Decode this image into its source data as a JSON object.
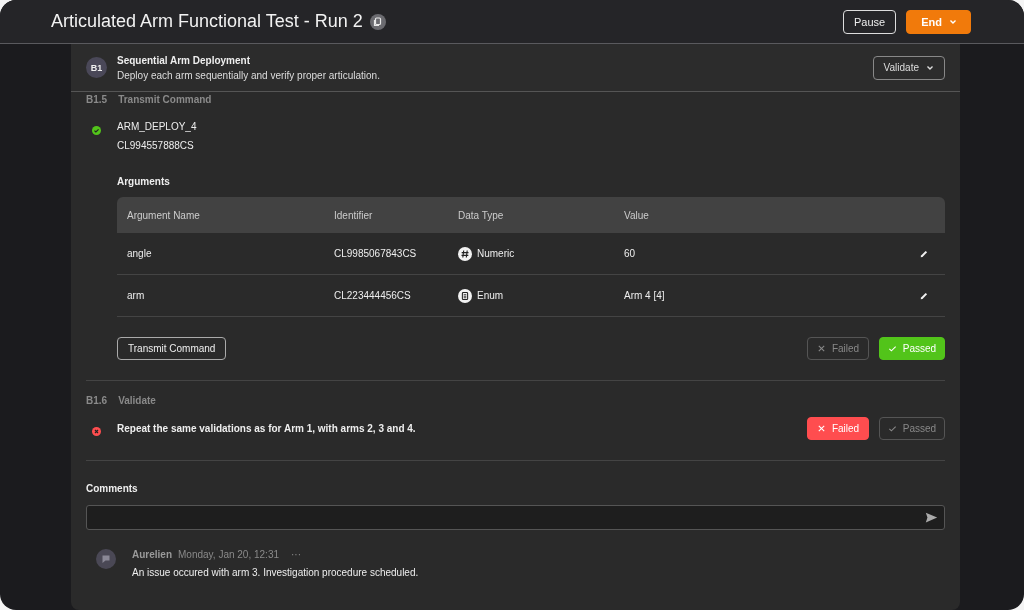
{
  "header": {
    "title": "Articulated Arm Functional Test - Run 2",
    "buttons": [
      {
        "label": "Pause",
        "kind": "outline"
      },
      {
        "label": "End",
        "kind": "primary"
      }
    ]
  },
  "block": {
    "badge": "B1",
    "title": "Sequential Arm Deployment",
    "description": "Deploy each arm sequentially and verify proper articulation.",
    "action": "Validate"
  },
  "steps": [
    {
      "number": "B1.5",
      "type": "Transmit Command",
      "passed": true,
      "kind": "command",
      "command": "ARM_DEPLOY_4",
      "identifier": "CL994557888CS",
      "arguments_title": "Arguments",
      "columns": [
        "Argument Name",
        "Identifier",
        "Data Type",
        "Value"
      ],
      "rows": [
        {
          "name": "angle",
          "identifier": "CL9985067843CS",
          "data_type": "Numeric",
          "kind": "numeric",
          "value": "60"
        },
        {
          "name": "arm",
          "identifier": "CL223444456CS",
          "data_type": "Enum",
          "kind": "enum",
          "value": "Arm 4 [4]"
        }
      ],
      "action": "Transmit Command",
      "verdicts": [
        {
          "label": "Failed",
          "kind": "failed",
          "selected": false
        },
        {
          "label": "Passed",
          "kind": "passed",
          "selected": true
        }
      ]
    },
    {
      "number": "B1.6",
      "type": "Validate",
      "passed": false,
      "kind": "validate",
      "text": "Repeat the same validations as for Arm 1, with arms 2, 3 and 4.",
      "verdicts": [
        {
          "label": "Failed",
          "kind": "failed",
          "selected": true
        },
        {
          "label": "Passed",
          "kind": "passed",
          "selected": false
        }
      ]
    }
  ],
  "comments": {
    "title": "Comments",
    "items": [
      {
        "author": "Aurelien",
        "time": "Monday, Jan 20, 12:31",
        "more": "···",
        "text": "An issue occured with arm 3. Investigation procedure scheduled."
      }
    ]
  }
}
